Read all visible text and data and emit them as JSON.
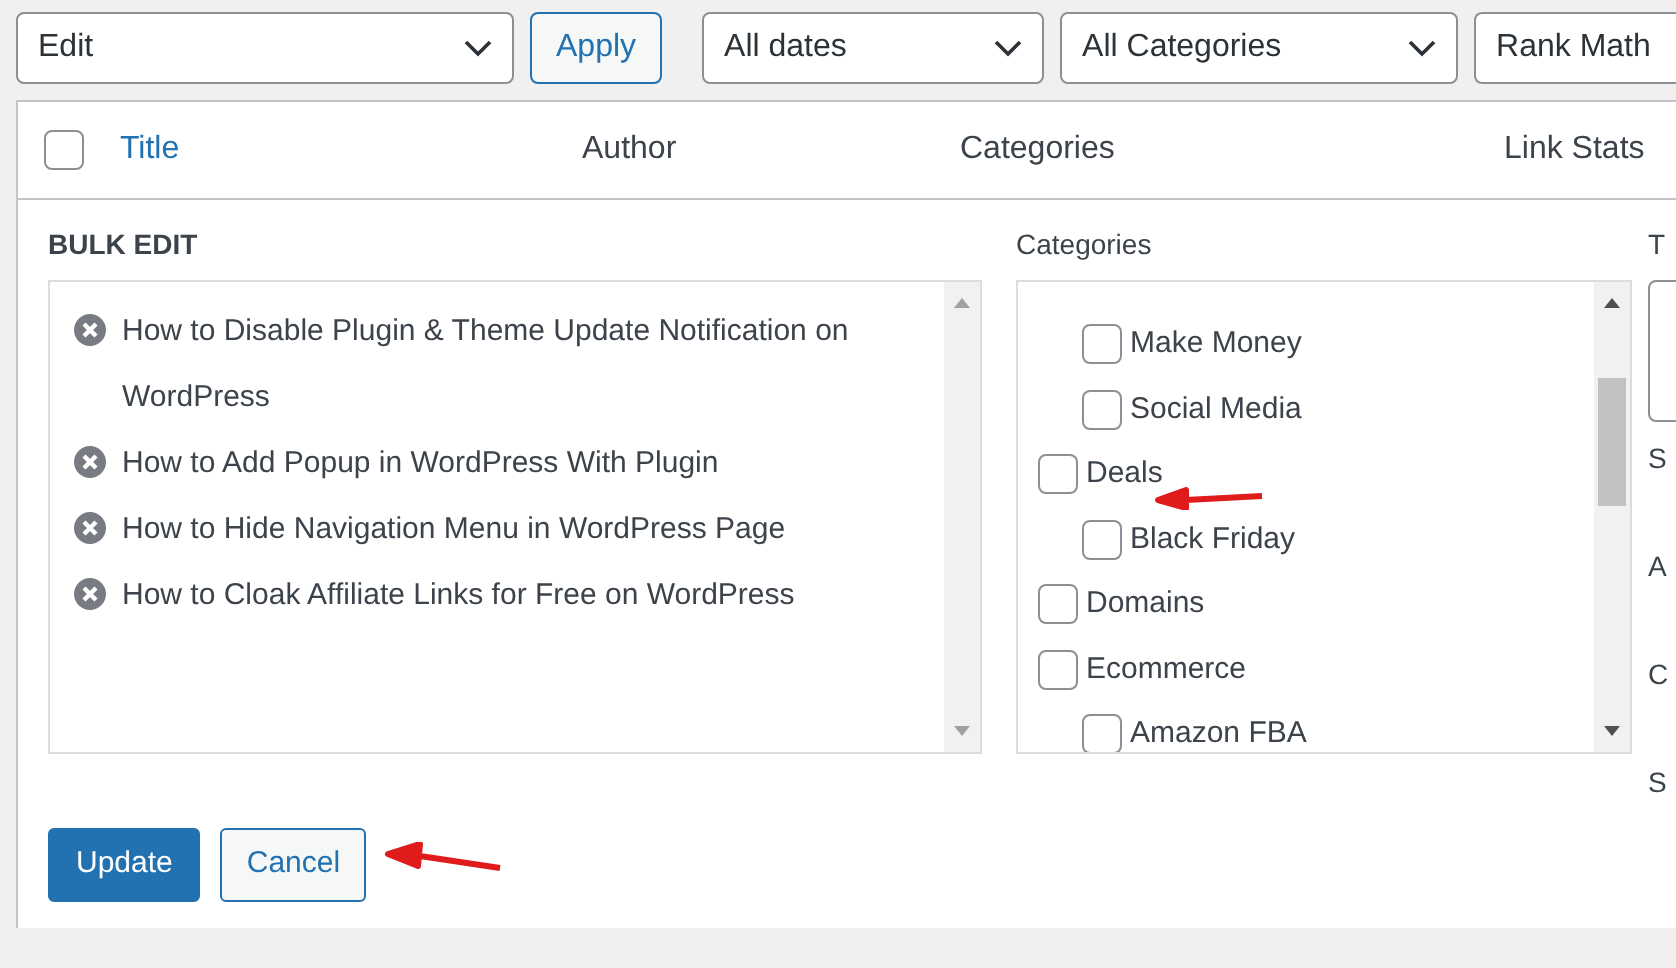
{
  "toolbar": {
    "bulk_action": "Edit",
    "apply": "Apply",
    "date_filter": "All dates",
    "category_filter": "All Categories",
    "seo_filter": "Rank Math"
  },
  "table": {
    "select_all_checked": false,
    "columns": [
      {
        "label": "Title",
        "sortable": true
      },
      {
        "label": "Author",
        "sortable": false
      },
      {
        "label": "Categories",
        "sortable": false
      },
      {
        "label": "Link Stats",
        "sortable": false
      }
    ]
  },
  "bulk_edit": {
    "heading": "BULK EDIT",
    "posts": [
      "How to Disable Plugin & Theme Update Notification on WordPress",
      "How to Add Popup in WordPress With Plugin",
      "How to Hide Navigation Menu in WordPress Page",
      "How to Cloak Affiliate Links for Free on WordPress"
    ],
    "categories_label": "Categories",
    "categories": [
      {
        "children": [
          {
            "label": "Make Money",
            "checked": false
          },
          {
            "label": "Social Media",
            "checked": false
          }
        ]
      },
      {
        "label": "Deals",
        "checked": false,
        "children": [
          {
            "label": "Black Friday",
            "checked": false
          }
        ]
      },
      {
        "label": "Domains",
        "checked": false
      },
      {
        "label": "Ecommerce",
        "checked": false,
        "children": [
          {
            "label": "Amazon FBA",
            "checked": false
          }
        ]
      }
    ],
    "tags_label": "T",
    "side_labels": [
      "S",
      "A",
      "C",
      "S"
    ],
    "update": "Update",
    "cancel": "Cancel"
  }
}
